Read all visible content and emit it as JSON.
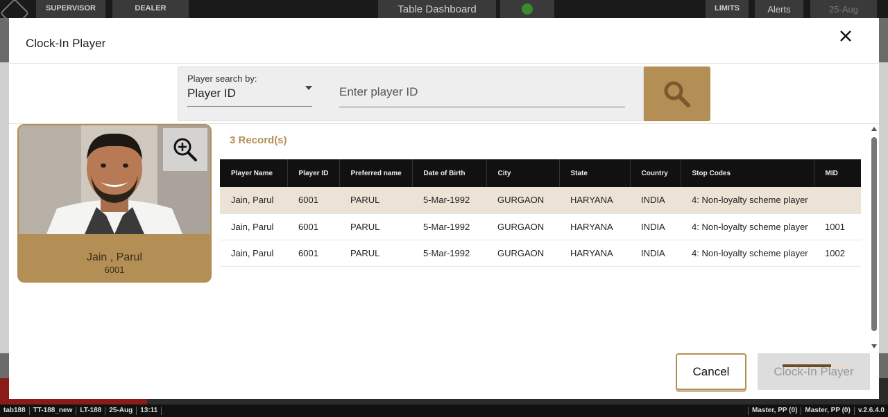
{
  "topbar": {
    "supervisor_label": "SUPERVISOR",
    "dealer_label": "DEALER",
    "dashboard_label": "Table Dashboard",
    "limits_label": "LIMITS",
    "alerts_label": "Alerts",
    "date_label": "25-Aug"
  },
  "modal": {
    "title": "Clock-In Player",
    "search": {
      "by_label": "Player search by:",
      "by_value": "Player ID",
      "placeholder": "Enter player ID"
    },
    "card": {
      "name": "Jain , Parul",
      "id": "6001"
    },
    "records_label": "3 Record(s)",
    "table": {
      "headers": [
        "Player Name",
        "Player ID",
        "Preferred name",
        "Date of Birth",
        "City",
        "State",
        "Country",
        "Stop Codes",
        "MID"
      ],
      "rows": [
        [
          "Jain, Parul",
          "6001",
          "PARUL",
          "5-Mar-1992",
          "GURGAON",
          "HARYANA",
          "INDIA",
          "4: Non-loyalty scheme player",
          ""
        ],
        [
          "Jain, Parul",
          "6001",
          "PARUL",
          "5-Mar-1992",
          "GURGAON",
          "HARYANA",
          "INDIA",
          "4: Non-loyalty scheme player",
          "1001"
        ],
        [
          "Jain, Parul",
          "6001",
          "PARUL",
          "5-Mar-1992",
          "GURGAON",
          "HARYANA",
          "INDIA",
          "4: Non-loyalty scheme player",
          "1002"
        ]
      ]
    },
    "cancel_label": "Cancel",
    "clockin_label": "Clock-In Player"
  },
  "statusbar": {
    "left": [
      "tab188",
      "TT-188_new",
      "LT-188",
      "25-Aug",
      "13:11"
    ],
    "right": [
      "Master, PP (0)",
      "Master, PP (0)",
      "v.2.6.4.0"
    ]
  },
  "colors": {
    "accent": "#b48f55",
    "selected_row": "#ece3d6",
    "table_header": "#111111"
  },
  "icons": {
    "close": "close-icon",
    "search": "search-icon",
    "zoom": "zoom-in-icon",
    "caret": "chevron-down-icon"
  }
}
